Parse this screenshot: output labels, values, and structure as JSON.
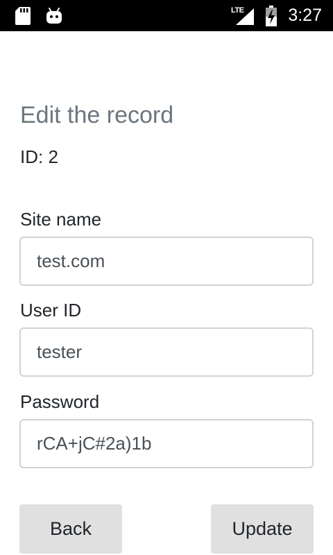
{
  "status_bar": {
    "network": "LTE",
    "time": "3:27",
    "icons": [
      "sd-card-icon",
      "android-icon",
      "signal-icon",
      "battery-icon"
    ]
  },
  "form": {
    "title": "Edit the record",
    "id_text": "ID: 2",
    "site_name": {
      "label": "Site name",
      "value": "test.com"
    },
    "user_id": {
      "label": "User ID",
      "value": "tester"
    },
    "password": {
      "label": "Password",
      "value": "rCA+jC#2a)1b"
    }
  },
  "buttons": {
    "back": "Back",
    "update": "Update"
  },
  "colors": {
    "status_bar_bg": "#000000",
    "title": "#6c757d",
    "input_border": "#ced4da",
    "button_bg": "#e0e0e0"
  }
}
